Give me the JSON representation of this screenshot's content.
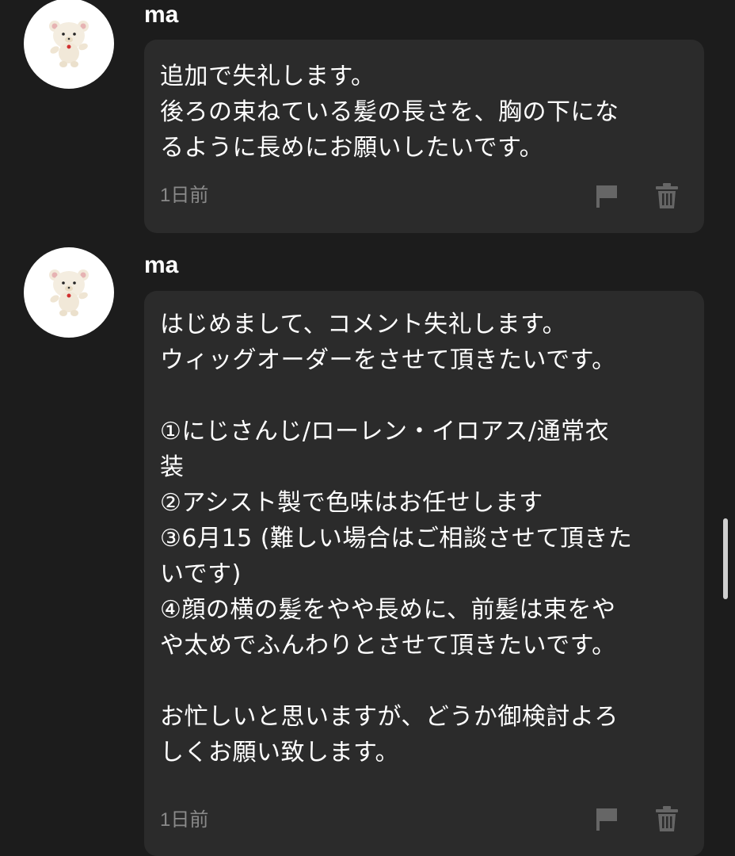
{
  "comments": [
    {
      "username": "ma",
      "avatar_icon": "bear-plush-icon",
      "text": "追加で失礼します。\n後ろの束ねている髪の長さを、胸の下にな\nるように長めにお願いしたいです。",
      "timestamp": "1日前",
      "actions": {
        "flag_icon": "flag-icon",
        "delete_icon": "trash-icon"
      }
    },
    {
      "username": "ma",
      "avatar_icon": "bear-plush-icon",
      "text": "はじめまして、コメント失礼します。\nウィッグオーダーをさせて頂きたいです。\n\n①にじさんじ/ローレン・イロアス/通常衣\n装\n②アシスト製で色味はお任せします\n③6月15 (難しい場合はご相談させて頂きた\nいです)\n④顔の横の髪をやや長めに、前髪は束をや\nや太めでふんわりとさせて頂きたいです。\n\nお忙しいと思いますが、どうか御検討よろ\nしくお願い致します。",
      "timestamp": "1日前",
      "actions": {
        "flag_icon": "flag-icon",
        "delete_icon": "trash-icon"
      }
    }
  ],
  "colors": {
    "background": "#1c1c1c",
    "bubble": "#2b2b2b",
    "text": "#ffffff",
    "muted": "#8a8a8a",
    "icon": "#666666"
  }
}
